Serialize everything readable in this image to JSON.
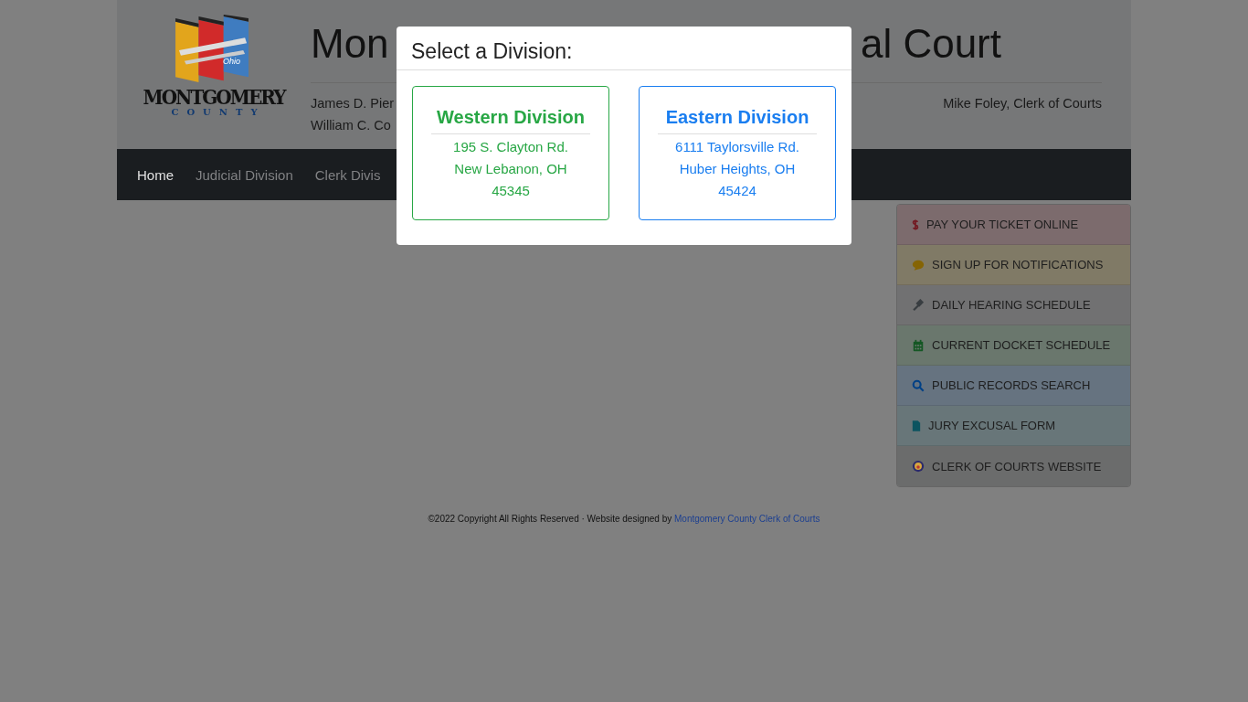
{
  "logo": {
    "name": "MONTGOMERY",
    "sub": "COUNTY",
    "script": "Ohio"
  },
  "header": {
    "title_left": "Mon",
    "title_right": "al Court",
    "officials_left": [
      "James D. Pier",
      "William C. Co"
    ],
    "officials_right": "Mike Foley, Clerk of Courts"
  },
  "nav": [
    {
      "label": "Home",
      "selected": true
    },
    {
      "label": "Judicial Division",
      "selected": false
    },
    {
      "label": "Clerk Divis",
      "selected": false
    }
  ],
  "quick_links": [
    {
      "kind": "dollar",
      "label": "PAY YOUR TICKET ONLINE",
      "color": "#7c6b6d"
    },
    {
      "kind": "chat",
      "label": "SIGN UP FOR NOTIFICATIONS",
      "color": "#807a66"
    },
    {
      "kind": "gavel",
      "label": "DAILY HEARING SCHEDULE",
      "color": "#717172"
    },
    {
      "kind": "calendar",
      "label": "CURRENT DOCKET SCHEDULE",
      "color": "#6a776d"
    },
    {
      "kind": "search",
      "label": "PUBLIC RECORDS SEARCH",
      "color": "#667380"
    },
    {
      "kind": "file",
      "label": "JURY EXCUSAL FORM",
      "color": "#687679"
    },
    {
      "kind": "seal",
      "label": "CLERK OF COURTS WEBSITE",
      "color": "#6b6c6c"
    }
  ],
  "footer": {
    "text": "©2022 Copyright All Rights Reserved · Website designed by",
    "link": "Montgomery County Clerk of Courts"
  },
  "modal": {
    "title": "Select a Division:",
    "divisions": [
      {
        "name": "Western Division",
        "address": [
          "195 S. Clayton Rd.",
          "New Lebanon, OH",
          "45345"
        ],
        "color": "#28a745"
      },
      {
        "name": "Eastern Division",
        "address": [
          "6111 Taylorsville Rd.",
          "Huber Heights, OH",
          "45424"
        ],
        "color": "#1a7ef0"
      }
    ]
  }
}
